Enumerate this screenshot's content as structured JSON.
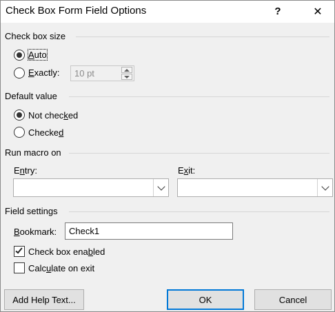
{
  "dialog": {
    "title": "Check Box Form Field Options",
    "help": "?",
    "close": "✕"
  },
  "size_section": {
    "label": "Check box size",
    "auto_prefix": "",
    "auto_u": "A",
    "auto_rest": "uto",
    "exactly_u": "E",
    "exactly_rest": "xactly:",
    "size_value": "10 pt",
    "selected": "Auto"
  },
  "default_section": {
    "label": "Default value",
    "not_checked_a": "Not chec",
    "not_checked_u": "k",
    "not_checked_b": "ed",
    "checked_a": "Checke",
    "checked_u": "d",
    "selected": "Not checked"
  },
  "macro_section": {
    "label": "Run macro on",
    "entry_a": "E",
    "entry_u": "n",
    "entry_b": "try:",
    "exit_a": "E",
    "exit_u": "x",
    "exit_b": "it:",
    "entry_value": "",
    "exit_value": ""
  },
  "field_section": {
    "label": "Field settings",
    "bookmark_u": "B",
    "bookmark_rest": "ookmark:",
    "bookmark_value": "Check1",
    "enabled_a": "Check box ena",
    "enabled_u": "b",
    "enabled_b": "led",
    "enabled_checked": true,
    "calc_a": "Calc",
    "calc_u": "u",
    "calc_b": "late on exit",
    "calc_checked": false
  },
  "buttons": {
    "help_text": "Add Help Text...",
    "ok": "OK",
    "cancel": "Cancel"
  }
}
